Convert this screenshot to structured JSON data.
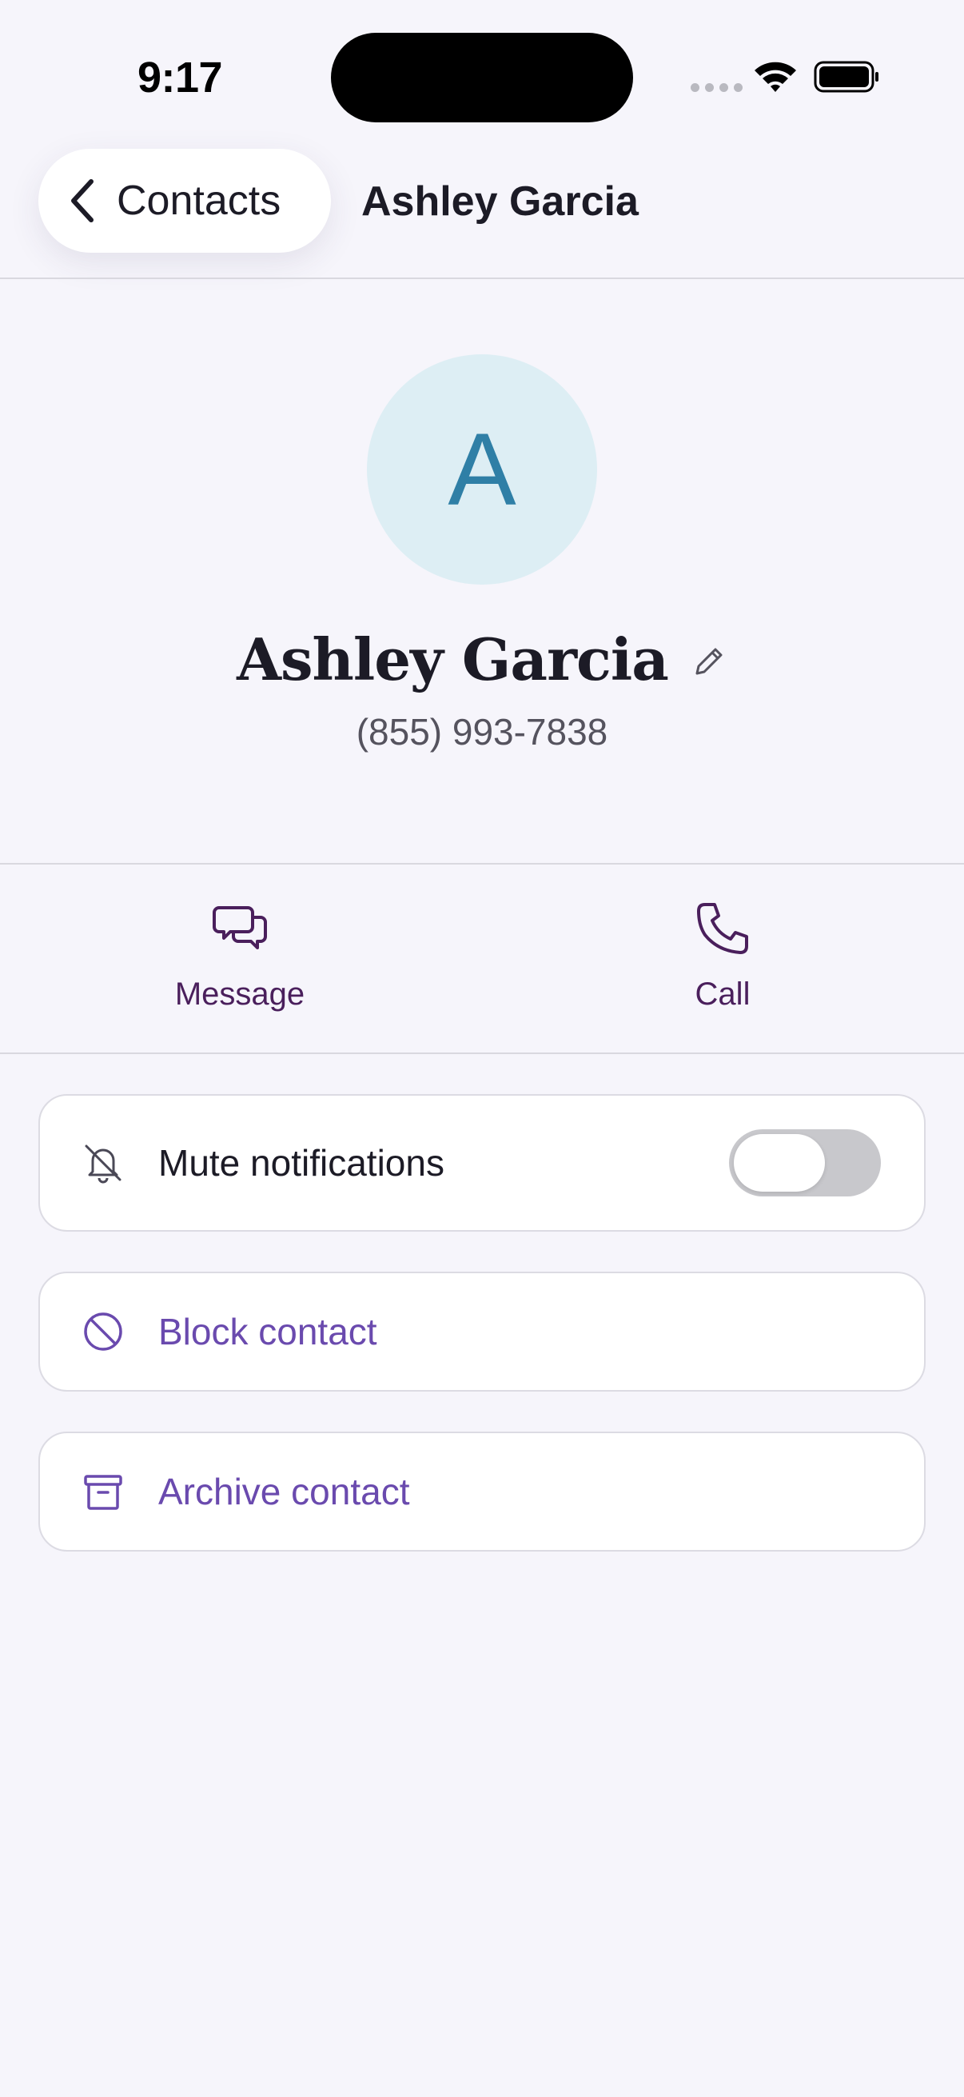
{
  "status_bar": {
    "time": "9:17"
  },
  "nav": {
    "back_label": "Contacts",
    "title": "Ashley Garcia"
  },
  "profile": {
    "avatar_initial": "A",
    "name": "Ashley Garcia",
    "phone": "(855) 993-7838"
  },
  "actions": [
    {
      "label": "Message",
      "icon": "chat-bubbles-icon"
    },
    {
      "label": "Call",
      "icon": "phone-icon"
    }
  ],
  "settings": {
    "mute": {
      "label": "Mute notifications",
      "enabled": false
    },
    "block": {
      "label": "Block contact"
    },
    "archive": {
      "label": "Archive contact"
    }
  },
  "colors": {
    "accent_purple": "#6a4aae",
    "action_purple": "#4a1f5c",
    "avatar_bg": "#ddeef4",
    "avatar_fg": "#2f7fa6",
    "background": "#f6f5fb"
  }
}
